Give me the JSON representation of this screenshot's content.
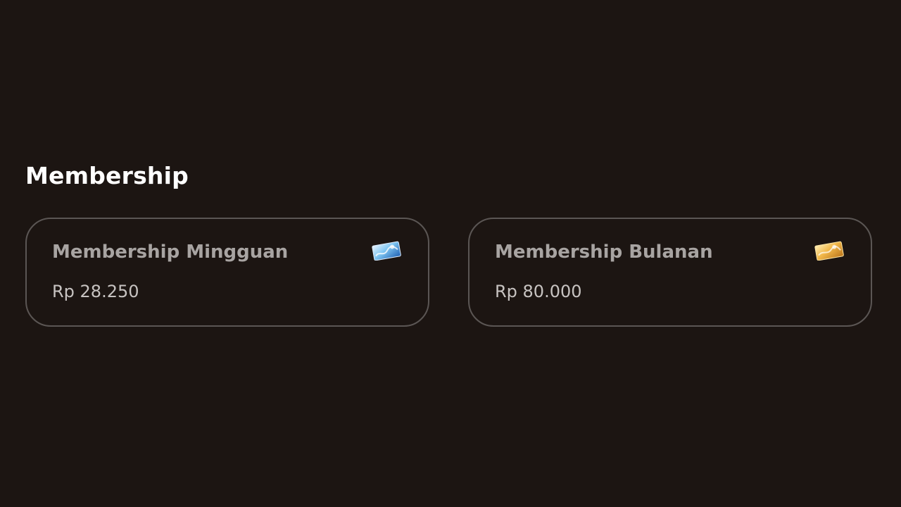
{
  "section": {
    "title": "Membership"
  },
  "plans": [
    {
      "name": "Membership Mingguan",
      "price": "Rp 28.250",
      "icon": "blue-card-icon",
      "icon_colors": [
        "#1e5fb3",
        "#7fc6f2",
        "#e8f4ff"
      ]
    },
    {
      "name": "Membership Bulanan",
      "price": "Rp 80.000",
      "icon": "gold-card-icon",
      "icon_colors": [
        "#b9731a",
        "#f2b84a",
        "#fff0b8"
      ]
    }
  ],
  "colors": {
    "background": "#1c1512",
    "card_border": "#5b5654",
    "title": "#ffffff",
    "plan_name": "#a8a4a2",
    "price": "#c7c3c1"
  }
}
